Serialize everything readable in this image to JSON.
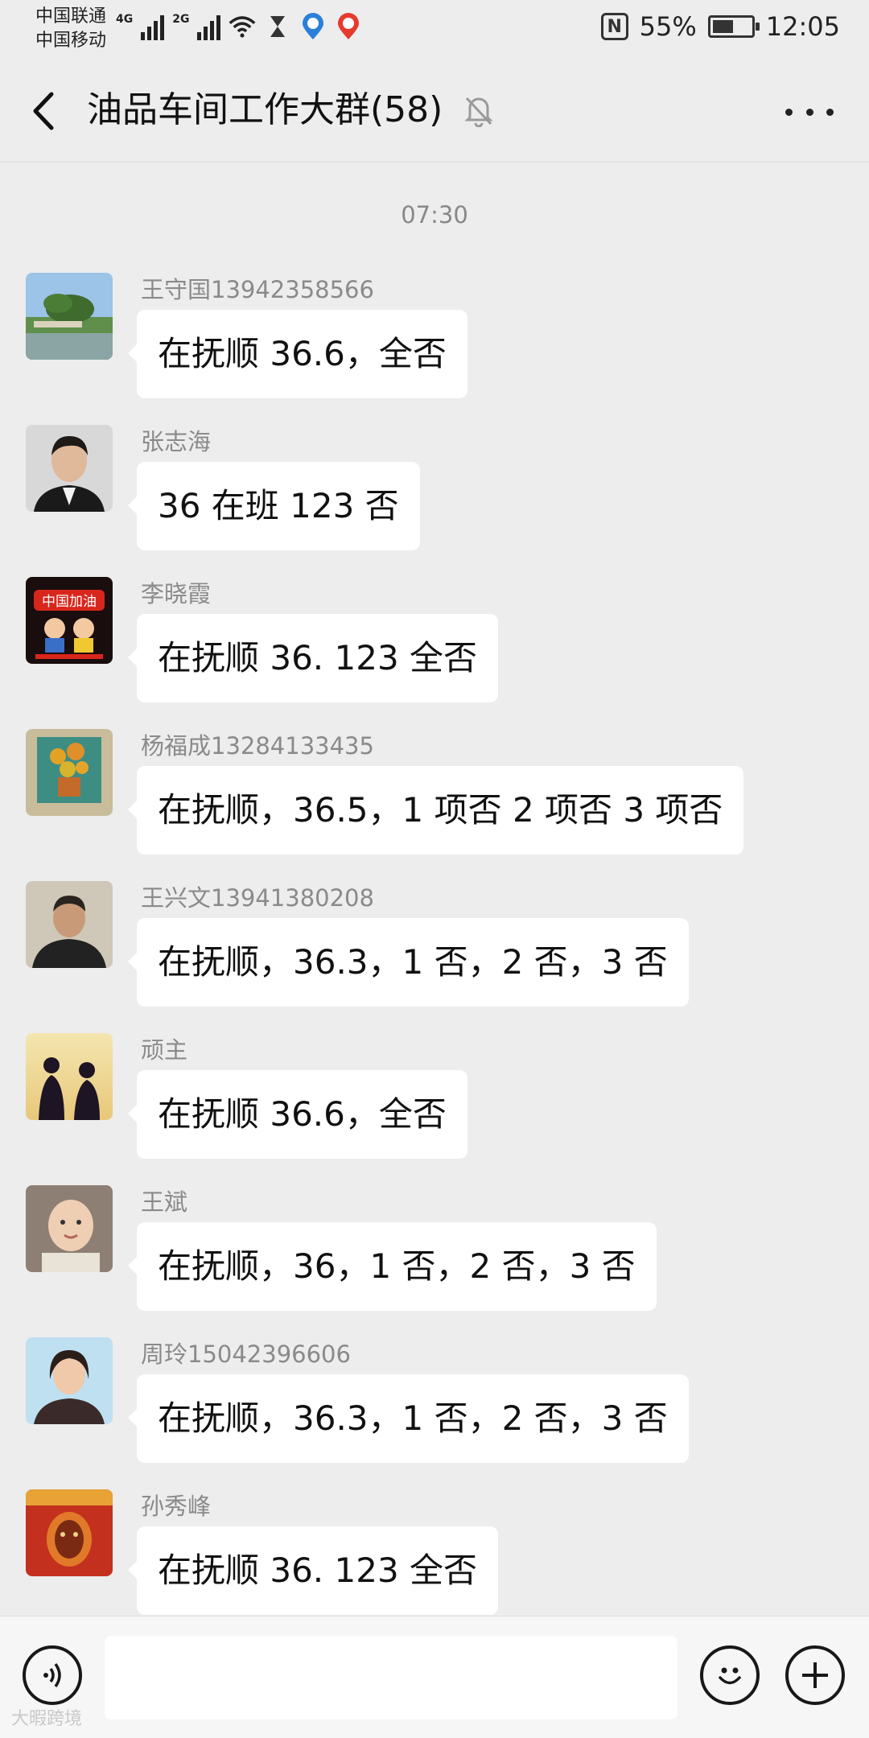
{
  "status_bar": {
    "carrier_1": "中国联通",
    "carrier_2": "中国移动",
    "net_1": "4G",
    "net_2": "2G",
    "battery": "55%",
    "battery_level": 0.55,
    "time": "12:05",
    "icons": [
      "signal-icon",
      "wifi-icon",
      "hourglass-icon",
      "map-pin-icon",
      "map-pin-red-icon",
      "nfc-icon",
      "battery-icon"
    ]
  },
  "header": {
    "title": "油品车间工作大群(58)",
    "icons": [
      "back-icon",
      "mute-bell-icon",
      "more-icon"
    ]
  },
  "chat": {
    "time": "07:30",
    "messages": [
      {
        "sender": "王守国13942358566",
        "text": "在抚顺 36.6，全否",
        "avatar": "landscape"
      },
      {
        "sender": "张志海",
        "text": "36 在班 123 否",
        "avatar": "portrait"
      },
      {
        "sender": "李晓霞",
        "text": "在抚顺 36. 123 全否",
        "avatar": "poster",
        "avatar_text": "中国加油"
      },
      {
        "sender": "杨福成13284133435",
        "text": "在抚顺，36.5，1 项否 2 项否 3 项否",
        "avatar": "flowers"
      },
      {
        "sender": "王兴文13941380208",
        "text": "在抚顺，36.3，1 否，2 否，3 否",
        "avatar": "man"
      },
      {
        "sender": "顽主",
        "text": "在抚顺 36.6，全否",
        "avatar": "silhouette"
      },
      {
        "sender": "王斌",
        "text": "在抚顺，36，1 否，2 否，3 否",
        "avatar": "baby"
      },
      {
        "sender": "周玲15042396606",
        "text": "在抚顺，36.3，1 否，2 否，3 否",
        "avatar": "woman"
      },
      {
        "sender": "孙秀峰",
        "text": "在抚顺 36. 123 全否",
        "avatar": "painting"
      }
    ]
  },
  "input_bar": {
    "icons": [
      "voice-icon",
      "emoji-icon",
      "plus-icon"
    ],
    "placeholder": ""
  },
  "watermark": "大暇跨境",
  "colors": {
    "background": "#ededed",
    "bubble": "#ffffff",
    "sender_text": "#8a8a8a"
  }
}
